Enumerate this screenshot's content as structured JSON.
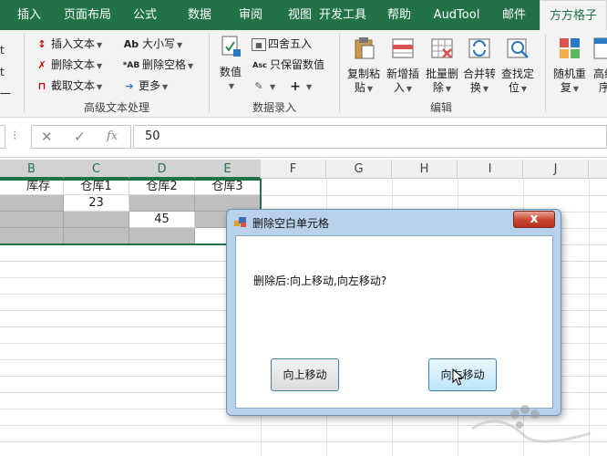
{
  "tabs": [
    {
      "label": "插入",
      "active": false
    },
    {
      "label": "页面布局",
      "active": false
    },
    {
      "label": "公式",
      "active": false
    },
    {
      "label": "数据",
      "active": false
    },
    {
      "label": "审阅",
      "active": false
    },
    {
      "label": "视图",
      "active": false
    },
    {
      "label": "开发工具",
      "active": false
    },
    {
      "label": "帮助",
      "active": false
    },
    {
      "label": "AudTool",
      "active": false
    },
    {
      "label": "邮件",
      "active": false
    },
    {
      "label": "方方格子",
      "active": true
    }
  ],
  "ribbon": {
    "left_partial": [
      "t",
      "t",
      "一"
    ],
    "group1": {
      "label": "高级文本处理",
      "items": [
        "插入文本",
        "删除文本",
        "截取文本",
        "大小写",
        "删除空格",
        "更多"
      ]
    },
    "group2": {
      "label": "数据录入",
      "numeric_label": "数值",
      "items": [
        "四舍五入",
        "只保留数值"
      ]
    },
    "group3": {
      "label": "编辑",
      "buttons": [
        {
          "line1": "复制粘",
          "line2": "贴"
        },
        {
          "line1": "新增插",
          "line2": "入"
        },
        {
          "line1": "批量删",
          "line2": "除"
        },
        {
          "line1": "合并转",
          "line2": "换"
        },
        {
          "line1": "查找定",
          "line2": "位"
        }
      ]
    },
    "group4": {
      "buttons": [
        {
          "line1": "随机重",
          "line2": "复"
        },
        {
          "line1": "高级",
          "line2": "序"
        }
      ]
    }
  },
  "formula_bar": {
    "value": "50"
  },
  "columns": [
    "B",
    "C",
    "D",
    "E",
    "F",
    "G",
    "H",
    "I",
    "J"
  ],
  "selected_columns": [
    "B",
    "C",
    "D",
    "E"
  ],
  "sheet": {
    "headers": [
      "库存",
      "仓库1",
      "仓库2",
      "仓库3"
    ],
    "c2": "23",
    "d3": "45",
    "e4_partial": "5"
  },
  "dialog": {
    "title": "删除空白单元格",
    "close": "x",
    "message": "删除后:向上移动,向左移动?",
    "btn_up": "向上移动",
    "btn_left": "向左移动"
  },
  "colors": {
    "excel_green": "#217346",
    "gray_fill": "#bfbfbf",
    "dialog_frame": "#b9d1ea"
  }
}
